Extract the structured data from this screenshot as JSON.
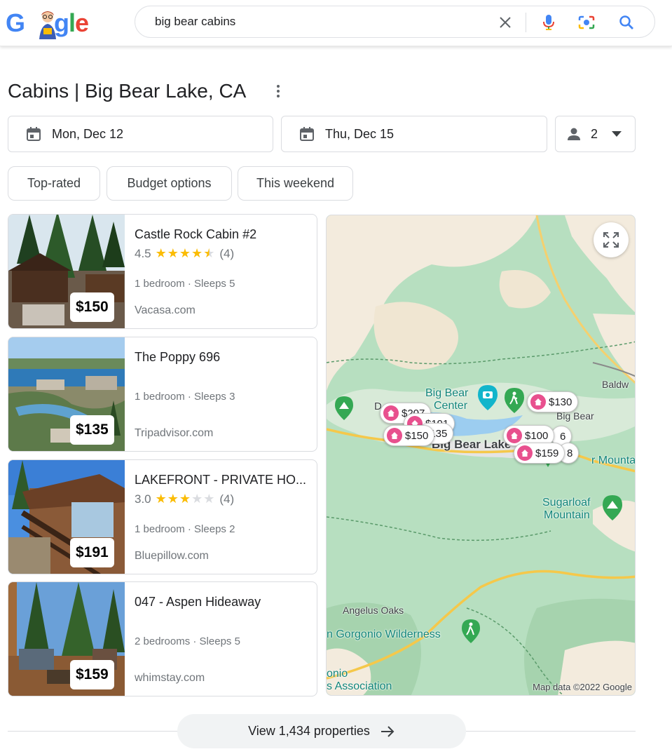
{
  "search": {
    "query": "big bear cabins"
  },
  "logo": {
    "text": "Google"
  },
  "page_title": "Cabins | Big Bear Lake, CA",
  "dates": {
    "check_in": "Mon, Dec 12",
    "check_out": "Thu, Dec 15"
  },
  "guests": {
    "count": "2"
  },
  "chips": [
    "Top-rated",
    "Budget options",
    "This weekend"
  ],
  "listings": [
    {
      "name": "Castle Rock Cabin #2",
      "rating": "4.5",
      "stars": 4.5,
      "reviews": "(4)",
      "details": "1 bedroom · Sleeps 5",
      "source": "Vacasa.com",
      "price": "$150"
    },
    {
      "name": "The Poppy 696",
      "details": "1 bedroom · Sleeps 3",
      "source": "Tripadvisor.com",
      "price": "$135"
    },
    {
      "name": "LAKEFRONT - PRIVATE HO...",
      "rating": "3.0",
      "stars": 3,
      "reviews": "(4)",
      "details": "1 bedroom · Sleeps 2",
      "source": "Bluepillow.com",
      "price": "$191"
    },
    {
      "name": "047 - Aspen Hideaway",
      "details": "2 bedrooms · Sleeps 5",
      "source": "whimstay.com",
      "price": "$159"
    }
  ],
  "map": {
    "pins": [
      "$130",
      "$207",
      "$191",
      "$135",
      "$150",
      "$100",
      "$159"
    ],
    "partial_pin_digits": [
      "6",
      "8"
    ],
    "labels": {
      "big_bear_center_1": "Big Bear",
      "big_bear_center_2": "Center",
      "big_bear_lake": "Big Bear Lake",
      "big_bear_city": "Big Bear",
      "baldwin": "Baldw",
      "sugarloaf_1": "Sugarloaf",
      "sugarloaf_2": "Mountain",
      "mountain_edge": "r Mounta",
      "angelus_oaks": "Angelus Oaks",
      "san_gorgonio": "n Gorgonio Wilderness",
      "association_1": "onio",
      "association_2": "s Association",
      "d_fragment": "D"
    },
    "credit": "Map data ©2022 Google",
    "colors": {
      "forest": "#b7dfc0",
      "land": "#f5efe3",
      "water": "#9ccdf0",
      "pin": "#e8508e"
    }
  },
  "footer": {
    "view_all": "View 1,434 properties"
  }
}
